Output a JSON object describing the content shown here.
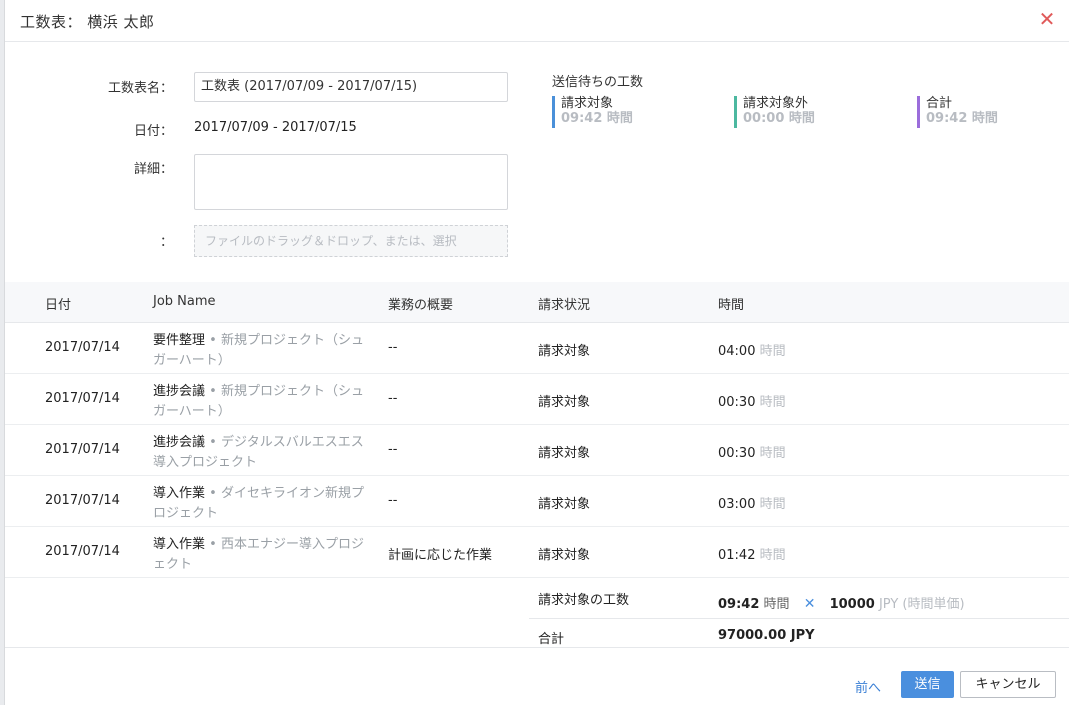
{
  "header": {
    "title": "工数表： 横浜 太郎"
  },
  "form": {
    "name_label": "工数表名：",
    "name_value": "工数表 (2017/07/09 - 2017/07/15)",
    "date_label": "日付：",
    "date_value": "2017/07/09 - 2017/07/15",
    "detail_label": "詳細：",
    "detail_value": "",
    "attach_label": "：",
    "attach_placeholder": "ファイルのドラッグ＆ドロップ、または、選択"
  },
  "pending": {
    "title": "送信待ちの工数",
    "stats": [
      {
        "label": "請求対象",
        "value": "09:42 時間",
        "color": "#4a90d9"
      },
      {
        "label": "請求対象外",
        "value": "00:00 時間",
        "color": "#4cb8a0"
      },
      {
        "label": "合計",
        "value": "09:42 時間",
        "color": "#9b6ddb"
      }
    ]
  },
  "table": {
    "headers": [
      "日付",
      "Job Name",
      "業務の概要",
      "請求状況",
      "時間"
    ],
    "rows": [
      {
        "date": "2017/07/14",
        "job": "要件整理",
        "project": " • 新規プロジェクト（シュガーハート）",
        "summary": "--",
        "status": "請求対象",
        "time": "04:00",
        "unit": "時間"
      },
      {
        "date": "2017/07/14",
        "job": "進捗会議",
        "project": " • 新規プロジェクト（シュガーハート）",
        "summary": "--",
        "status": "請求対象",
        "time": "00:30",
        "unit": "時間"
      },
      {
        "date": "2017/07/14",
        "job": "進捗会議",
        "project": " • デジタルスバルエスエス導入プロジェクト",
        "summary": "--",
        "status": "請求対象",
        "time": "00:30",
        "unit": "時間"
      },
      {
        "date": "2017/07/14",
        "job": "導入作業",
        "project": " • ダイセキライオン新規プロジェクト",
        "summary": "--",
        "status": "請求対象",
        "time": "03:00",
        "unit": "時間"
      },
      {
        "date": "2017/07/14",
        "job": "導入作業",
        "project": " • 西本エナジー導入プロジェクト",
        "summary": "計画に応じた作業",
        "status": "請求対象",
        "time": "01:42",
        "unit": "時間"
      }
    ]
  },
  "totals": {
    "billable_label": "請求対象の工数",
    "billable_hours": "09:42",
    "hours_unit": "時間",
    "multiply_icon": "times-icon",
    "rate": "10000",
    "rate_currency": "JPY",
    "rate_note": "(時間単価)",
    "total_label": "合計",
    "total_value": "97000.00 JPY"
  },
  "footer": {
    "prev_label": "前へ",
    "submit_label": "送信",
    "cancel_label": "キャンセル"
  }
}
